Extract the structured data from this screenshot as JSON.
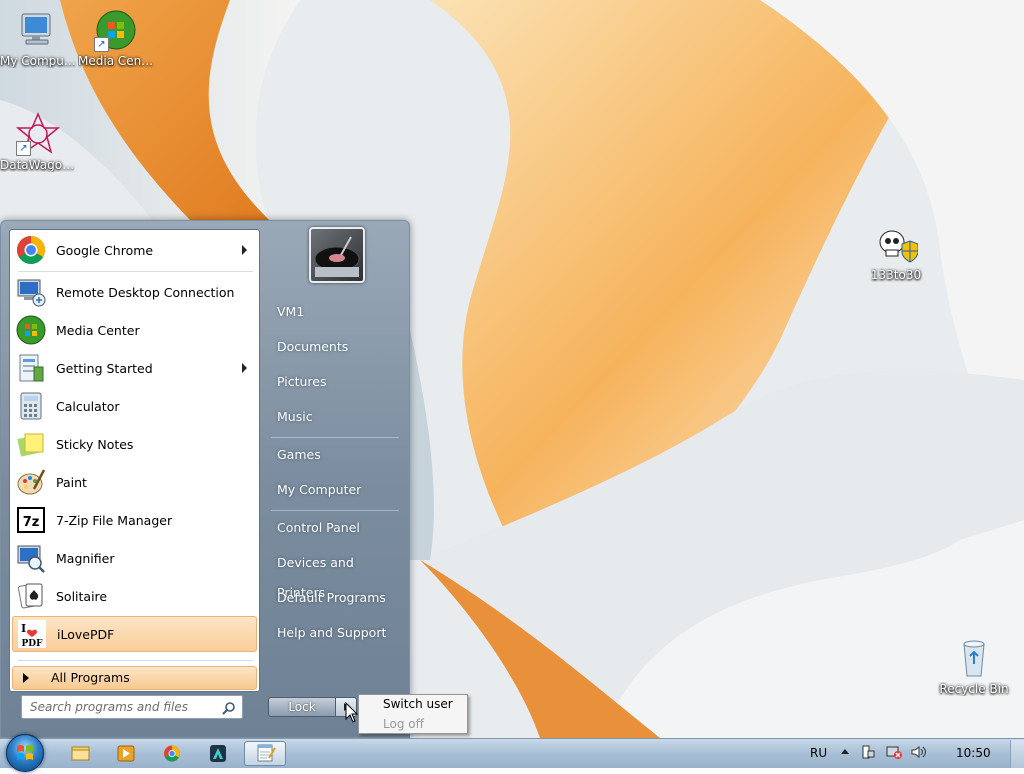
{
  "desktop": {
    "icons": [
      {
        "label": "My Computer"
      },
      {
        "label": "Media Center"
      },
      {
        "label": "DataWagon..."
      },
      {
        "label": "133to30"
      },
      {
        "label": "Recycle Bin"
      }
    ]
  },
  "start_menu": {
    "programs": [
      {
        "label": "Google Chrome",
        "icon": "chrome-icon",
        "has_submenu": true
      },
      {
        "label": "Remote Desktop Connection",
        "icon": "remote-desktop-icon"
      },
      {
        "label": "Media Center",
        "icon": "media-center-icon"
      },
      {
        "label": "Getting Started",
        "icon": "getting-started-icon",
        "has_submenu": true
      },
      {
        "label": "Calculator",
        "icon": "calculator-icon"
      },
      {
        "label": "Sticky Notes",
        "icon": "sticky-notes-icon"
      },
      {
        "label": "Paint",
        "icon": "paint-icon"
      },
      {
        "label": "7-Zip File Manager",
        "icon": "seven-zip-icon"
      },
      {
        "label": "Magnifier",
        "icon": "magnifier-icon"
      },
      {
        "label": "Solitaire",
        "icon": "solitaire-icon"
      },
      {
        "label": "iLovePDF",
        "icon": "ilovepdf-icon",
        "highlighted": true
      }
    ],
    "all_programs": "All Programs",
    "search_placeholder": "Search programs and files",
    "right_items": [
      {
        "label": "VM1"
      },
      {
        "label": "Documents"
      },
      {
        "label": "Pictures"
      },
      {
        "label": "Music"
      },
      {
        "label": "Games"
      },
      {
        "label": "My Computer"
      },
      {
        "label": "Control Panel"
      },
      {
        "label": "Devices and Printers"
      },
      {
        "label": "Default Programs"
      },
      {
        "label": "Help and Support"
      }
    ],
    "power_button": "Lock",
    "power_menu": {
      "switch_user": "Switch user",
      "log_off": "Log off"
    }
  },
  "taskbar": {
    "language": "RU",
    "clock": "10:50",
    "pinned": [
      "explorer-icon",
      "media-player-icon",
      "chrome-icon",
      "arch-icon",
      "notepad-icon"
    ]
  },
  "colors": {
    "highlight": "#f9cd99",
    "menu_bg": "#7b8d9f",
    "taskbar": "#aac1d8"
  }
}
